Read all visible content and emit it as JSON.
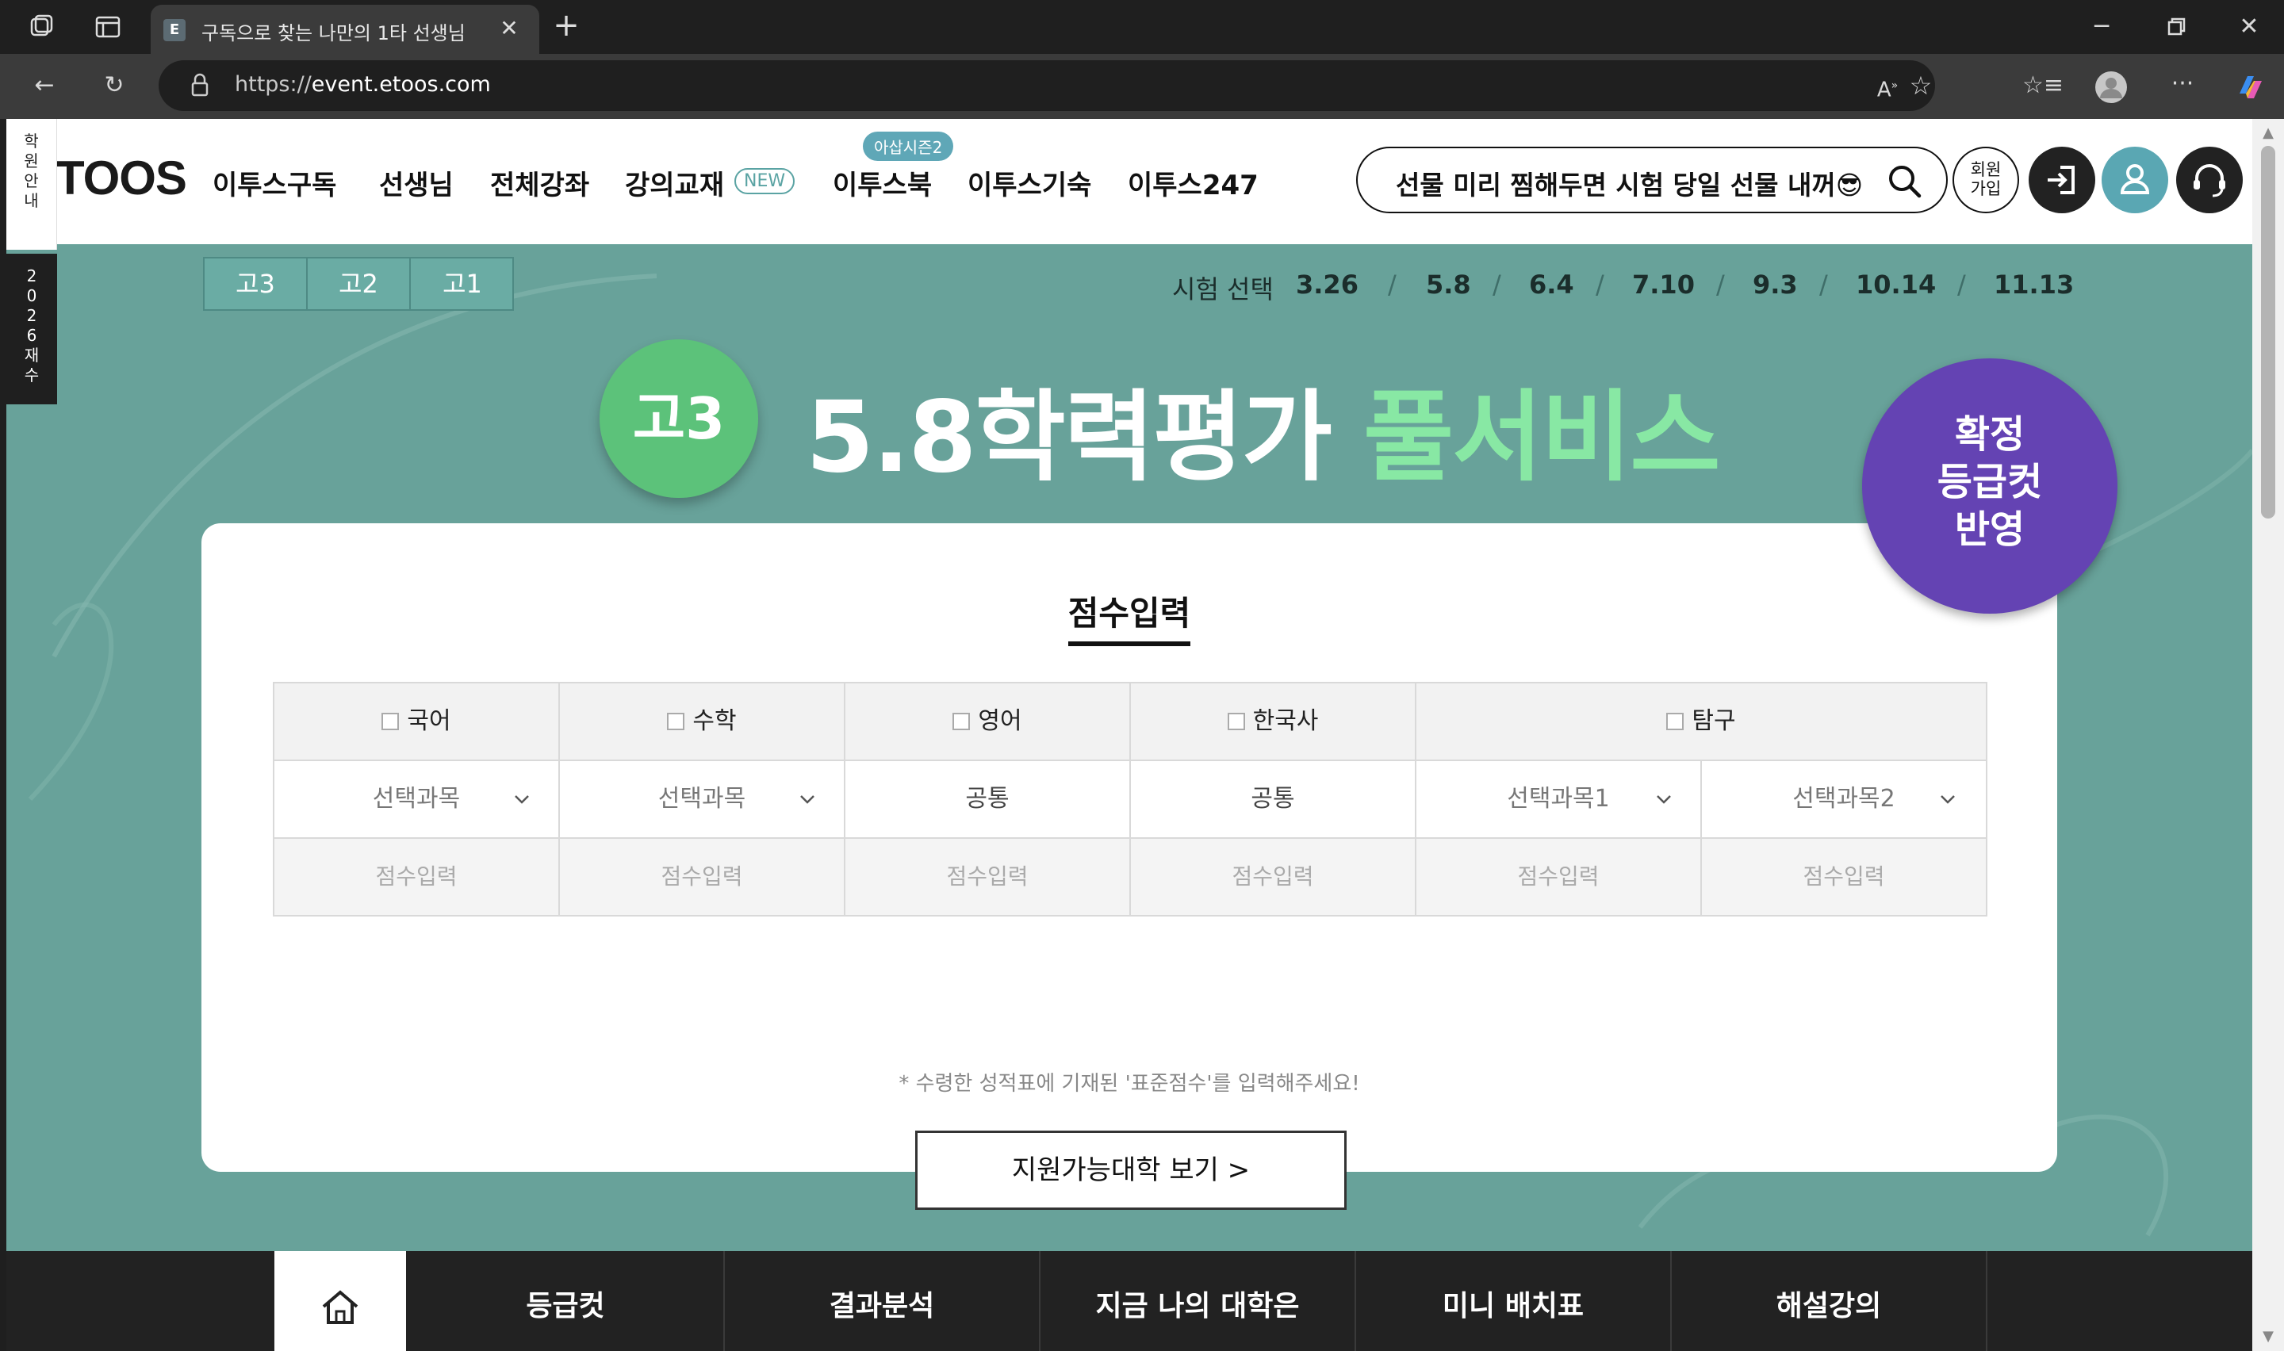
{
  "browser": {
    "tab_title": "구독으로 찾는 나만의 1타 선생님",
    "tab_favicon": "E",
    "url_prefix": "https://",
    "url_domain": "event.etoos.com"
  },
  "side_tabs": {
    "academy": "학원안내",
    "retake": "2026재수"
  },
  "header": {
    "logo": "TOOS",
    "nav": [
      {
        "label": "이투스구독"
      },
      {
        "label": "선생님"
      },
      {
        "label": "전체강좌"
      },
      {
        "label": "강의교재",
        "badge": "NEW"
      },
      {
        "label": "이투스북",
        "bubble": "아삽시즌2"
      },
      {
        "label": "이투스기숙"
      },
      {
        "label": "이투스247"
      }
    ],
    "search_text": "선물 미리 찜해두면 시험 당일 선물 내꺼😎",
    "signup_label": "회원\n가입"
  },
  "grades": [
    "고3",
    "고2",
    "고1"
  ],
  "exam": {
    "label": "시험 선택",
    "dates": [
      "3.26",
      "5.8",
      "6.4",
      "7.10",
      "9.3",
      "10.14",
      "11.13"
    ],
    "separator": "/"
  },
  "hero": {
    "grade_badge": "고3",
    "title_main": "5.8학력평가 ",
    "title_highlight": "풀서비스",
    "confirm_badge": "확정\n등급컷\n반영"
  },
  "card": {
    "title": "점수입력",
    "subjects": [
      "국어",
      "수학",
      "영어",
      "한국사",
      "탐구"
    ],
    "selects": [
      "선택과목",
      "선택과목",
      "공통",
      "공통",
      "선택과목1",
      "선택과목2"
    ],
    "input_placeholder": "점수입력",
    "note": "* 수령한 성적표에 기재된 '표준점수'를 입력해주세요!",
    "button": "지원가능대학 보기 >"
  },
  "bottom_nav": [
    "등급컷",
    "결과분석",
    "지금 나의 대학은",
    "미니 배치표",
    "해설강의"
  ],
  "colors": {
    "page_bg": "#68a29a",
    "hero_green": "#5cc27a",
    "highlight": "#88e8a4",
    "badge_purple": "#6443b3",
    "login_dark": "#222222",
    "profile_teal": "#5aa7b3"
  }
}
